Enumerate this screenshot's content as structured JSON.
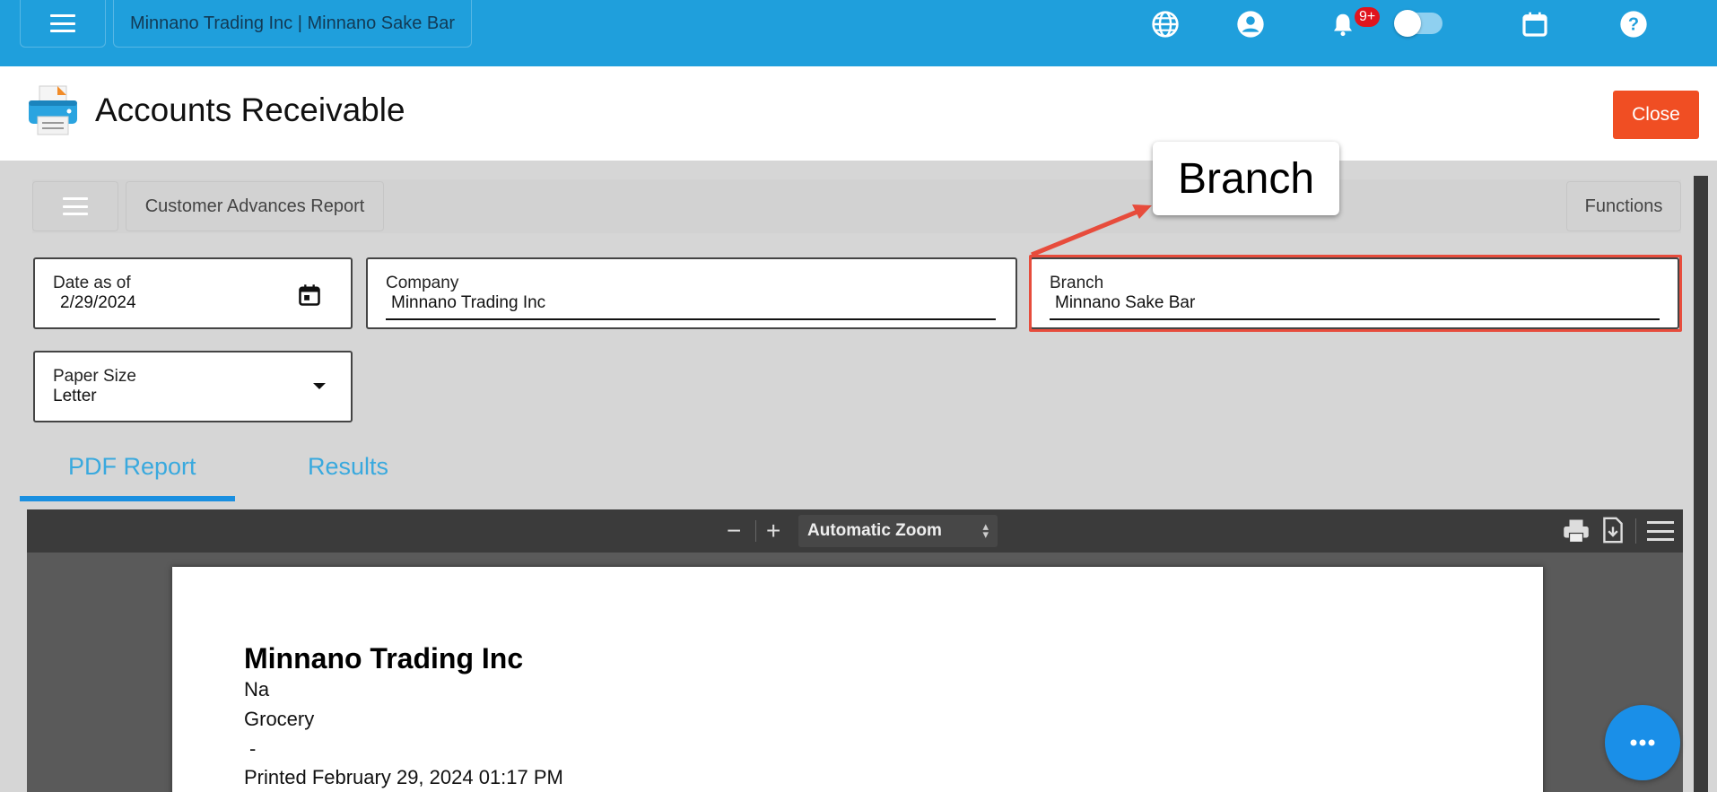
{
  "topbar": {
    "company_label": "Minnano Trading Inc | Minnano Sake Bar",
    "notification_count": "9+",
    "icons": [
      "menu-icon",
      "globe-icon",
      "account-icon",
      "bell-icon",
      "toggle",
      "moon-icon",
      "calendar-icon",
      "help-icon"
    ]
  },
  "header": {
    "title": "Accounts Receivable",
    "close_label": "Close",
    "close_color": "#f04e23"
  },
  "subbar": {
    "report_name": "Customer Advances Report",
    "functions_label": "Functions"
  },
  "fields": {
    "date": {
      "label": "Date as of",
      "value": "2/29/2024"
    },
    "company": {
      "label": "Company",
      "value": "Minnano Trading Inc"
    },
    "branch": {
      "label": "Branch",
      "value": "Minnano Sake Bar"
    },
    "paper_size": {
      "label": "Paper Size",
      "value": "Letter"
    }
  },
  "callout": {
    "text": "Branch"
  },
  "tabs": [
    {
      "label": "PDF Report",
      "active": true
    },
    {
      "label": "Results",
      "active": false
    }
  ],
  "pdf_viewer": {
    "zoom": "Automatic Zoom",
    "page": {
      "company": "Minnano Trading Inc",
      "line1": "Na",
      "line2": "Grocery",
      "line3": "-",
      "printed": "Printed February 29, 2024 01:17 PM"
    }
  },
  "colors": {
    "topbar": "#1f9fdc",
    "accent": "#1a8fe0",
    "highlight": "#e74c3c"
  }
}
